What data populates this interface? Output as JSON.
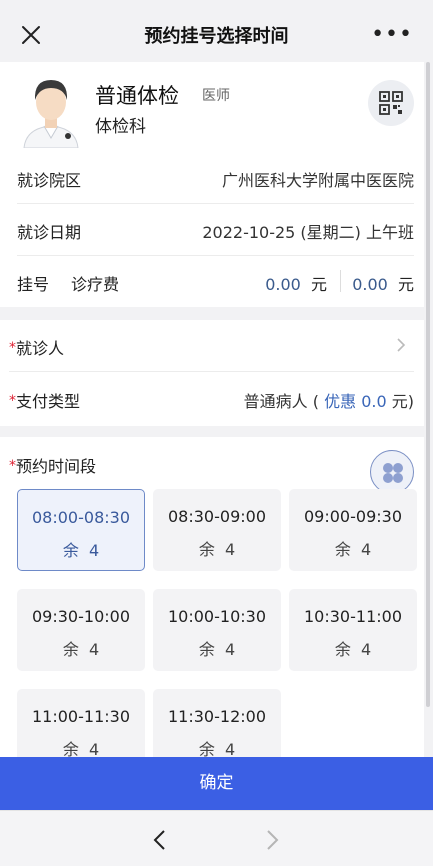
{
  "nav": {
    "title": "预约挂号选择时间",
    "more": "•••"
  },
  "doctor": {
    "name": "普通体检",
    "title": "医师",
    "department": "体检科"
  },
  "info": {
    "campus_label": "就诊院区",
    "campus_value": "广州医科大学附属中医医院",
    "date_label": "就诊日期",
    "date_value": "2022-10-25 (星期二) 上午班",
    "fee_label_1": "挂号",
    "fee_label_2": "诊疗费",
    "fee_1_amount": "0.00",
    "fee_1_unit": "元",
    "fee_2_amount": "0.00",
    "fee_2_unit": "元"
  },
  "patient": {
    "required_mark": "*",
    "patient_label": "就诊人",
    "payment_label": "支付类型",
    "payment_prefix": "普通病人 (",
    "payment_discount_label": "优惠",
    "payment_discount_value": "0.0",
    "payment_suffix": "元)"
  },
  "slots": {
    "required_mark": "*",
    "heading": "预约时间段",
    "remaining_prefix": "余",
    "items": [
      {
        "time": "08:00-08:30",
        "remaining": "4",
        "selected": true
      },
      {
        "time": "08:30-09:00",
        "remaining": "4",
        "selected": false
      },
      {
        "time": "09:00-09:30",
        "remaining": "4",
        "selected": false
      },
      {
        "time": "09:30-10:00",
        "remaining": "4",
        "selected": false
      },
      {
        "time": "10:00-10:30",
        "remaining": "4",
        "selected": false
      },
      {
        "time": "10:30-11:00",
        "remaining": "4",
        "selected": false
      },
      {
        "time": "11:00-11:30",
        "remaining": "4",
        "selected": false
      },
      {
        "time": "11:30-12:00",
        "remaining": "4",
        "selected": false
      }
    ]
  },
  "footer": {
    "confirm_label": "确定"
  },
  "colors": {
    "primary": "#3b5fe4",
    "accent_text": "#3a5a8c",
    "required": "#d23333",
    "selected_border": "#6e8ac8"
  },
  "icons": {
    "close": "close-icon",
    "more": "more-icon",
    "qr": "qr-code-icon",
    "chevron": "chevron-right-icon",
    "mode": "clover-icon",
    "back": "back-arrow-icon",
    "forward": "forward-arrow-icon"
  }
}
